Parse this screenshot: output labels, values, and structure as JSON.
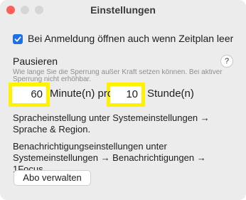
{
  "window": {
    "title": "Einstellungen",
    "traffic_light_colors": {
      "close": "#ff5f57",
      "inactive": "#d6d6d6"
    }
  },
  "open_on_login": {
    "checked": true,
    "label": "Bei Anmeldung öffnen auch wenn Zeitplan leer"
  },
  "pause": {
    "title": "Pausieren",
    "help_label": "?",
    "hint": "Wie lange Sie die Sperrung außer Kraft setzen können. Bei aktiver Sperrung nicht erhöhbar.",
    "minutes_value": "60",
    "minutes_unit": "Minute(n) pro",
    "hours_value": "10",
    "hours_unit": "Stunde(n)"
  },
  "language_info": "Spracheinstellung unter Systemeinstellungen → Sprache & Region.",
  "notifications_info": "Benachrichtigungseinstellungen unter Systemeinstellungen → Benachrichtigungen → 1Focus.",
  "manage_subscription_label": "Abo verwalten",
  "colors": {
    "accent": "#1f6fe5",
    "highlight": "#fff200",
    "window_bg": "#ececec"
  }
}
